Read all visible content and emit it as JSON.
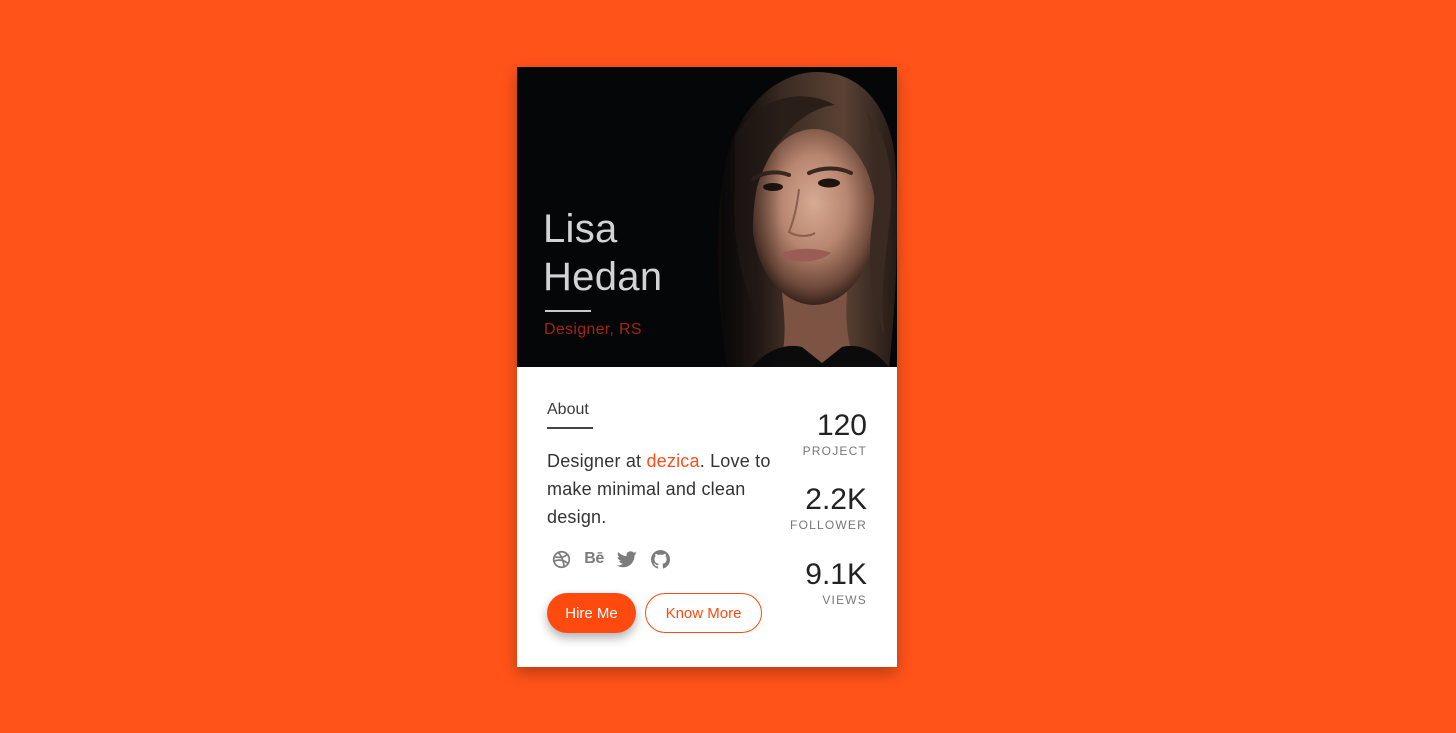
{
  "profile": {
    "first_name": "Lisa",
    "last_name": "Hedan",
    "role": "Designer, RS"
  },
  "about": {
    "heading": "About",
    "text_before": "Designer at ",
    "company": "dezica",
    "text_after": ". Love to make minimal and clean design."
  },
  "socials": [
    {
      "icon": "dribbble-icon"
    },
    {
      "icon": "behance-icon",
      "label": "Bē"
    },
    {
      "icon": "twitter-icon"
    },
    {
      "icon": "github-icon"
    }
  ],
  "buttons": {
    "hire": "Hire Me",
    "more": "Know More"
  },
  "stats": [
    {
      "value": "120",
      "label": "PROJECT"
    },
    {
      "value": "2.2K",
      "label": "FOLLOWER"
    },
    {
      "value": "9.1K",
      "label": "VIEWS"
    }
  ],
  "colors": {
    "background": "#ff5319",
    "accent": "#ff4a0f",
    "hero": "#050607",
    "role": "#a3260c"
  }
}
